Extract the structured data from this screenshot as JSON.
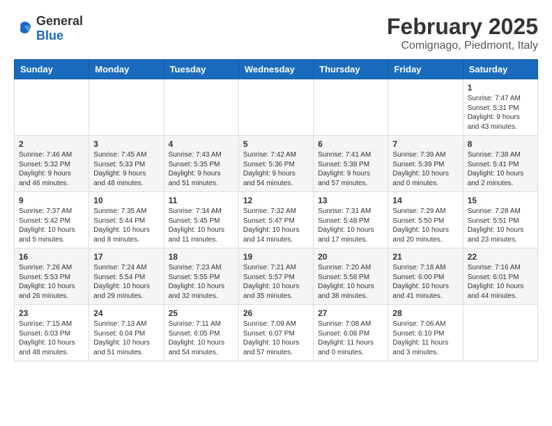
{
  "logo": {
    "text_general": "General",
    "text_blue": "Blue"
  },
  "title": "February 2025",
  "location": "Comignago, Piedmont, Italy",
  "days_of_week": [
    "Sunday",
    "Monday",
    "Tuesday",
    "Wednesday",
    "Thursday",
    "Friday",
    "Saturday"
  ],
  "weeks": [
    [
      {
        "day": "",
        "info": ""
      },
      {
        "day": "",
        "info": ""
      },
      {
        "day": "",
        "info": ""
      },
      {
        "day": "",
        "info": ""
      },
      {
        "day": "",
        "info": ""
      },
      {
        "day": "",
        "info": ""
      },
      {
        "day": "1",
        "info": "Sunrise: 7:47 AM\nSunset: 5:31 PM\nDaylight: 9 hours and 43 minutes."
      }
    ],
    [
      {
        "day": "2",
        "info": "Sunrise: 7:46 AM\nSunset: 5:32 PM\nDaylight: 9 hours and 46 minutes."
      },
      {
        "day": "3",
        "info": "Sunrise: 7:45 AM\nSunset: 5:33 PM\nDaylight: 9 hours and 48 minutes."
      },
      {
        "day": "4",
        "info": "Sunrise: 7:43 AM\nSunset: 5:35 PM\nDaylight: 9 hours and 51 minutes."
      },
      {
        "day": "5",
        "info": "Sunrise: 7:42 AM\nSunset: 5:36 PM\nDaylight: 9 hours and 54 minutes."
      },
      {
        "day": "6",
        "info": "Sunrise: 7:41 AM\nSunset: 5:38 PM\nDaylight: 9 hours and 57 minutes."
      },
      {
        "day": "7",
        "info": "Sunrise: 7:39 AM\nSunset: 5:39 PM\nDaylight: 10 hours and 0 minutes."
      },
      {
        "day": "8",
        "info": "Sunrise: 7:38 AM\nSunset: 5:41 PM\nDaylight: 10 hours and 2 minutes."
      }
    ],
    [
      {
        "day": "9",
        "info": "Sunrise: 7:37 AM\nSunset: 5:42 PM\nDaylight: 10 hours and 5 minutes."
      },
      {
        "day": "10",
        "info": "Sunrise: 7:35 AM\nSunset: 5:44 PM\nDaylight: 10 hours and 8 minutes."
      },
      {
        "day": "11",
        "info": "Sunrise: 7:34 AM\nSunset: 5:45 PM\nDaylight: 10 hours and 11 minutes."
      },
      {
        "day": "12",
        "info": "Sunrise: 7:32 AM\nSunset: 5:47 PM\nDaylight: 10 hours and 14 minutes."
      },
      {
        "day": "13",
        "info": "Sunrise: 7:31 AM\nSunset: 5:48 PM\nDaylight: 10 hours and 17 minutes."
      },
      {
        "day": "14",
        "info": "Sunrise: 7:29 AM\nSunset: 5:50 PM\nDaylight: 10 hours and 20 minutes."
      },
      {
        "day": "15",
        "info": "Sunrise: 7:28 AM\nSunset: 5:51 PM\nDaylight: 10 hours and 23 minutes."
      }
    ],
    [
      {
        "day": "16",
        "info": "Sunrise: 7:26 AM\nSunset: 5:53 PM\nDaylight: 10 hours and 26 minutes."
      },
      {
        "day": "17",
        "info": "Sunrise: 7:24 AM\nSunset: 5:54 PM\nDaylight: 10 hours and 29 minutes."
      },
      {
        "day": "18",
        "info": "Sunrise: 7:23 AM\nSunset: 5:55 PM\nDaylight: 10 hours and 32 minutes."
      },
      {
        "day": "19",
        "info": "Sunrise: 7:21 AM\nSunset: 5:57 PM\nDaylight: 10 hours and 35 minutes."
      },
      {
        "day": "20",
        "info": "Sunrise: 7:20 AM\nSunset: 5:58 PM\nDaylight: 10 hours and 38 minutes."
      },
      {
        "day": "21",
        "info": "Sunrise: 7:18 AM\nSunset: 6:00 PM\nDaylight: 10 hours and 41 minutes."
      },
      {
        "day": "22",
        "info": "Sunrise: 7:16 AM\nSunset: 6:01 PM\nDaylight: 10 hours and 44 minutes."
      }
    ],
    [
      {
        "day": "23",
        "info": "Sunrise: 7:15 AM\nSunset: 6:03 PM\nDaylight: 10 hours and 48 minutes."
      },
      {
        "day": "24",
        "info": "Sunrise: 7:13 AM\nSunset: 6:04 PM\nDaylight: 10 hours and 51 minutes."
      },
      {
        "day": "25",
        "info": "Sunrise: 7:11 AM\nSunset: 6:05 PM\nDaylight: 10 hours and 54 minutes."
      },
      {
        "day": "26",
        "info": "Sunrise: 7:09 AM\nSunset: 6:07 PM\nDaylight: 10 hours and 57 minutes."
      },
      {
        "day": "27",
        "info": "Sunrise: 7:08 AM\nSunset: 6:08 PM\nDaylight: 11 hours and 0 minutes."
      },
      {
        "day": "28",
        "info": "Sunrise: 7:06 AM\nSunset: 6:10 PM\nDaylight: 11 hours and 3 minutes."
      },
      {
        "day": "",
        "info": ""
      }
    ]
  ]
}
